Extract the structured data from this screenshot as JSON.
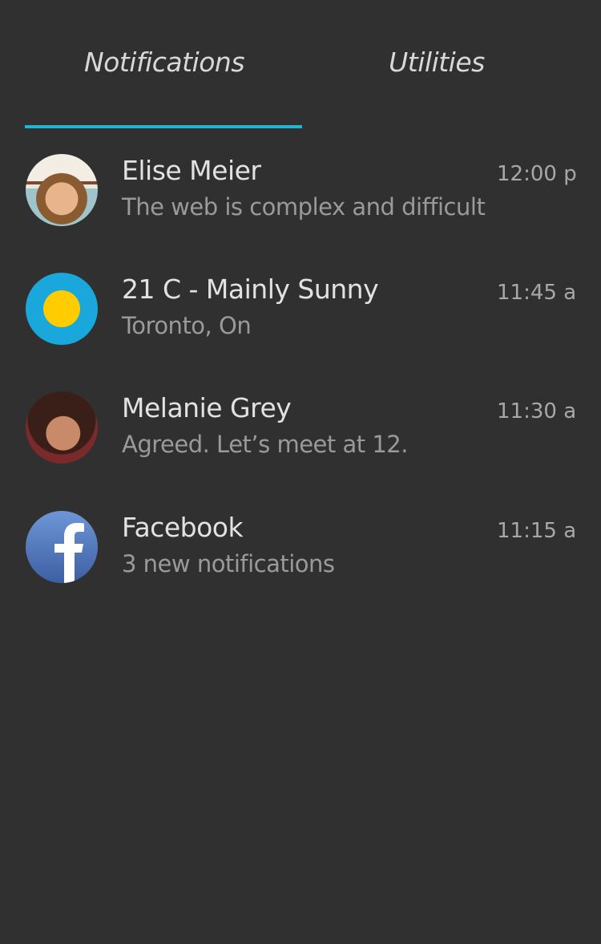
{
  "tabs": [
    {
      "label": "Notifications",
      "active": true
    },
    {
      "label": "Utilities",
      "active": false
    }
  ],
  "accent_color": "#1fb6d6",
  "notifications": [
    {
      "title": "Elise Meier",
      "subtitle": "The web is complex and difficult",
      "time": "12:00 p",
      "icon": "avatar-photo"
    },
    {
      "title": "21 C - Mainly Sunny",
      "subtitle": "Toronto, On",
      "time": "11:45 a",
      "icon": "sun-icon"
    },
    {
      "title": "Melanie Grey",
      "subtitle": "Agreed. Let’s meet at 12.",
      "time": "11:30 a",
      "icon": "avatar-photo"
    },
    {
      "title": "Facebook",
      "subtitle": "3 new notifications",
      "time": "11:15 a",
      "icon": "facebook-icon"
    }
  ]
}
